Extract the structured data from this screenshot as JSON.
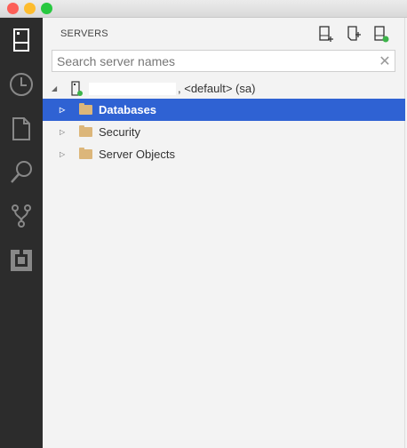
{
  "window": {
    "traffic_colors": {
      "close": "#fc5f57",
      "minimize": "#fdbc2e",
      "maximize": "#28c840"
    }
  },
  "sidebar": {
    "header": "SERVERS",
    "search": {
      "placeholder": "Search server names",
      "value": ""
    },
    "tree": {
      "server": {
        "suffix": ", <default> (sa)",
        "status_color": "#3cb34a"
      },
      "children": [
        {
          "label": "Databases",
          "selected": true
        },
        {
          "label": "Security",
          "selected": false
        },
        {
          "label": "Server Objects",
          "selected": false
        }
      ]
    }
  },
  "colors": {
    "selection": "#2f62d3",
    "activity_bar": "#2c2c2c",
    "folder": "#dcb67a"
  }
}
